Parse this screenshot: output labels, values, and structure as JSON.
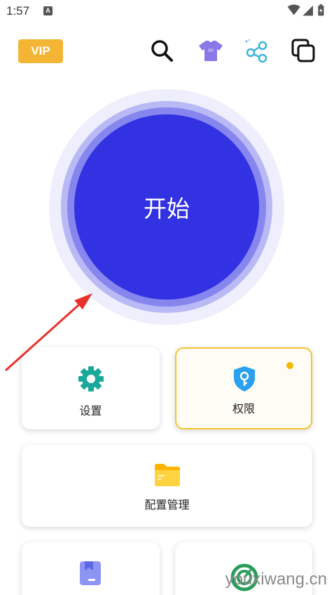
{
  "status_bar": {
    "time": "1:57",
    "notification_badge": "A"
  },
  "header": {
    "vip_label": "VIP",
    "icons": [
      "search-icon",
      "tshirt-icon",
      "share-icon",
      "copy-icon"
    ]
  },
  "start_button": {
    "label": "开始"
  },
  "cards": {
    "settings": {
      "label": "设置"
    },
    "permissions": {
      "label": "权限"
    },
    "config_management": {
      "label": "配置管理"
    }
  },
  "watermark": "youxiwang.cn",
  "colors": {
    "vip": "#f3b533",
    "start_button": "#3232e2",
    "settings_icon": "#1aa89a",
    "permission_icon": "#2aa0f0",
    "folder_icon": "#ffc630",
    "annotation_arrow": "#e8322c"
  }
}
